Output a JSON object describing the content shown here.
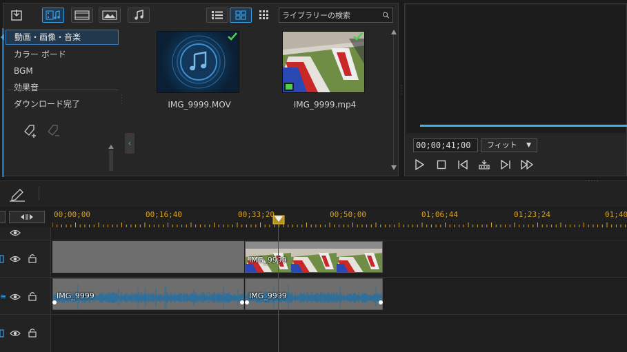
{
  "toolbar": {
    "search_placeholder": "ライブラリーの検索"
  },
  "categories": [
    {
      "label": "動画・画像・音楽",
      "selected": true
    },
    {
      "label": "カラー ボード",
      "selected": false
    },
    {
      "label": "BGM",
      "selected": false
    },
    {
      "label": "効果音",
      "selected": false
    },
    {
      "label": "ダウンロード完了",
      "selected": false
    }
  ],
  "media": [
    {
      "name": "IMG_9999.MOV",
      "type": "audio"
    },
    {
      "name": "IMG_9999.mp4",
      "type": "video"
    }
  ],
  "preview": {
    "timecode": "00;00;41;00",
    "fit": "フィット"
  },
  "timeline": {
    "ruler_labels": [
      "00;00;00",
      "00;16;40",
      "00;33;20",
      "00;50;00",
      "01;06;44",
      "01;23;24",
      "01;40"
    ],
    "clips": {
      "video_clip_title": "IMG_9999",
      "audio_clip_1_title": "IMG_9999",
      "audio_clip_2_title": "IMG_9999"
    }
  },
  "colors": {
    "accent": "#3aa0e0",
    "ruler_text": "#d9a021",
    "playhead": "#d21b1b",
    "progress": "#3fb6e8",
    "audio_wave": "#2f6f9a"
  }
}
